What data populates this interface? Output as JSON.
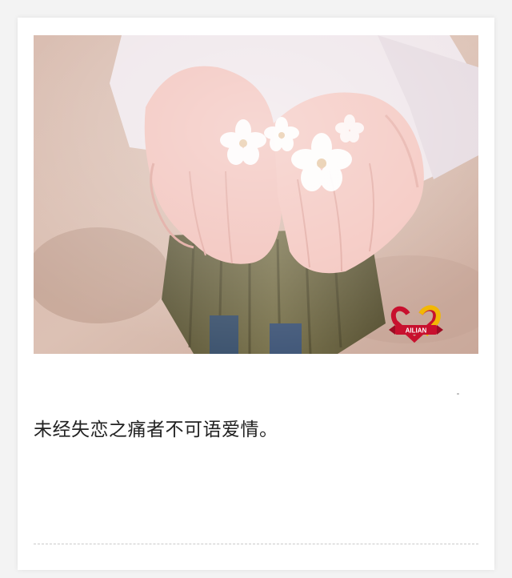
{
  "article": {
    "caption": "未经失恋之痛者不可语爱情。"
  },
  "photo": {
    "description_icon": "hands-holding-flowers-image",
    "watermark": {
      "text": "AILIAN",
      "colors": [
        "#c8102e",
        "#f2b705"
      ]
    }
  },
  "colors": {
    "page_bg": "#f3f3f3",
    "card_bg": "#ffffff",
    "text": "#222222",
    "divider": "#c9c9c9"
  }
}
